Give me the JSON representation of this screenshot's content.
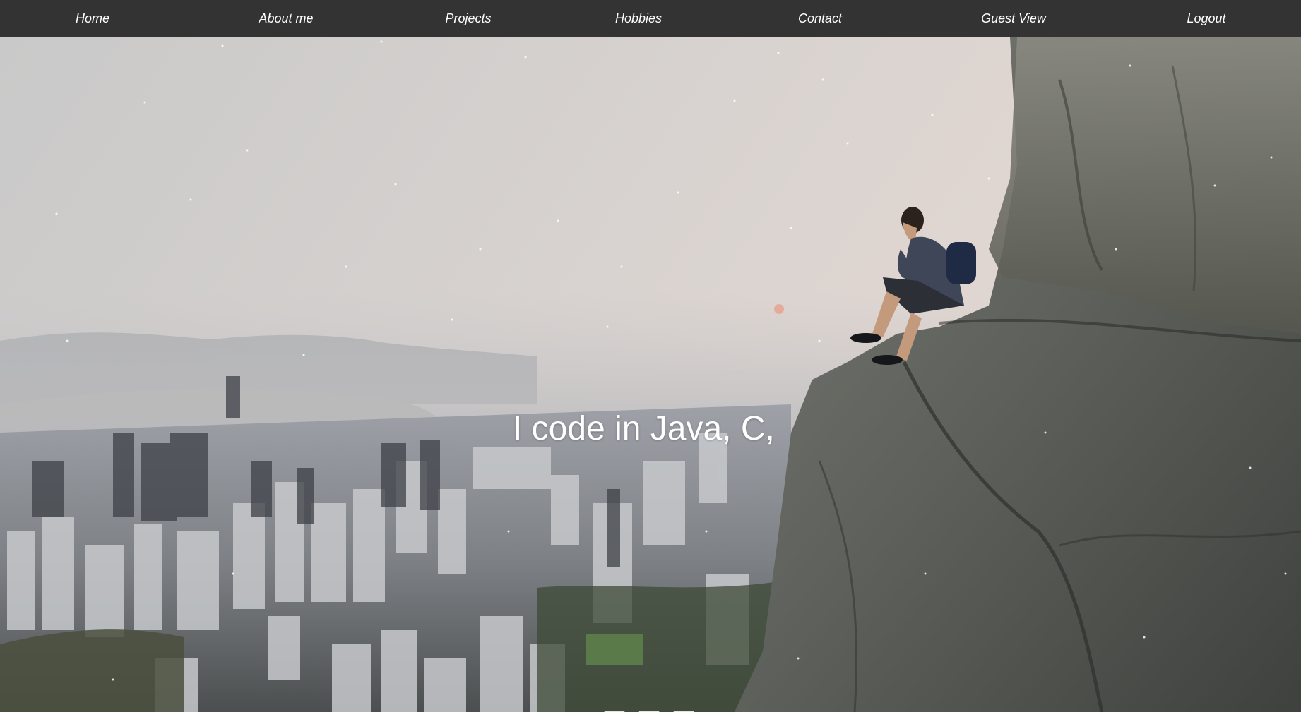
{
  "nav": {
    "items": [
      {
        "label": "Home"
      },
      {
        "label": "About me"
      },
      {
        "label": "Projects"
      },
      {
        "label": "Hobbies"
      },
      {
        "label": "Contact"
      },
      {
        "label": "Guest View"
      },
      {
        "label": "Logout"
      }
    ]
  },
  "hero": {
    "typed_text": "I code in Java, C,",
    "scroll_icon": "triple-down-triangle-icon"
  },
  "colors": {
    "navbar_bg": "#333333",
    "nav_text": "#ffffff",
    "hero_text": "#ffffff"
  }
}
